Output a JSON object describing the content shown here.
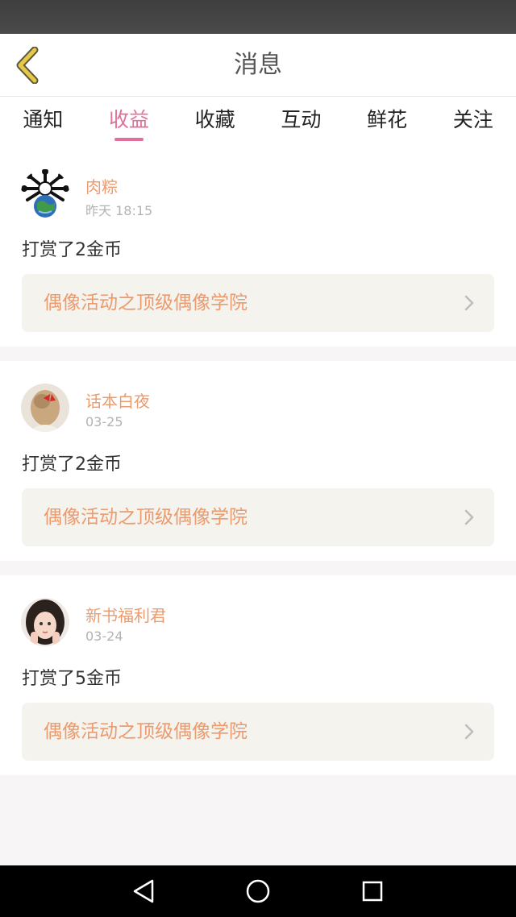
{
  "header": {
    "title": "消息",
    "back_icon": "chevron-left-icon"
  },
  "tabs": [
    {
      "label": "通知",
      "active": false
    },
    {
      "label": "收益",
      "active": true
    },
    {
      "label": "收藏",
      "active": false
    },
    {
      "label": "互动",
      "active": false
    },
    {
      "label": "鲜花",
      "active": false
    },
    {
      "label": "关注",
      "active": false
    }
  ],
  "messages": [
    {
      "user": "肉粽",
      "time": "昨天 18:15",
      "text": "打赏了2金币",
      "book": "偶像活动之顶级偶像学院"
    },
    {
      "user": "话本白夜",
      "time": "03-25",
      "text": "打赏了2金币",
      "book": "偶像活动之顶级偶像学院"
    },
    {
      "user": "新书福利君",
      "time": "03-24",
      "text": "打赏了5金币",
      "book": "偶像活动之顶级偶像学院"
    }
  ],
  "colors": {
    "accent": "#e0709a",
    "name": "#ec9b6e",
    "card_link_bg": "#f4f3ee",
    "back_arrow": "#e8c84a"
  },
  "nav": {
    "icons": [
      "back-triangle-icon",
      "home-circle-icon",
      "recents-square-icon"
    ]
  }
}
